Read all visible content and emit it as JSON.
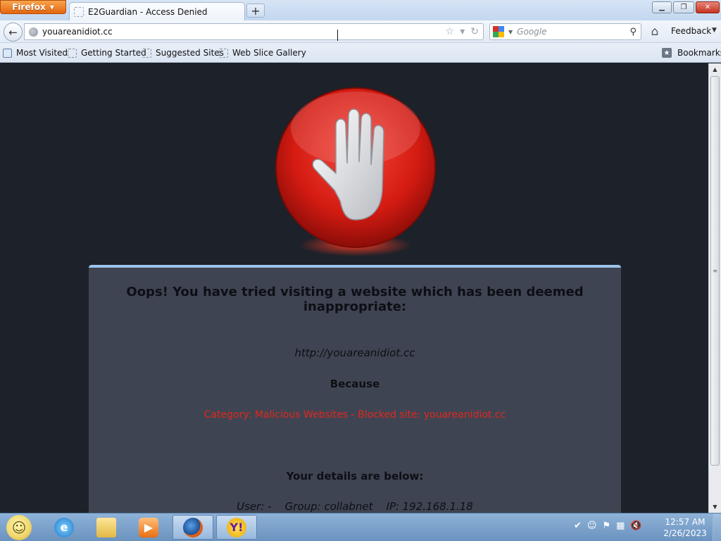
{
  "browser": {
    "menu_button": "Firefox",
    "tab_title": "E2Guardian - Access Denied",
    "new_tab": "+",
    "url": "youareanidiot.cc",
    "search_placeholder": "Google",
    "feedback": "Feedback"
  },
  "bookmarks": [
    "Most Visited",
    "Getting Started",
    "Suggested Sites",
    "Web Slice Gallery"
  ],
  "bookmarks_menu": "Bookmarks",
  "page": {
    "heading": "Oops! You have tried visiting a website which has been deemed inappropriate:",
    "blocked_url": "http://youareanidiot.cc",
    "because": "Because",
    "reason": "Category: Malicious Websites - Blocked site: youareanidiot.cc",
    "details_heading": "Your details are below:",
    "details": "User: -    Group: collabnet    IP: 192.168.1.18"
  },
  "taskbar": {
    "time": "12:57 AM",
    "date": "2/26/2023",
    "apps": [
      "internet-explorer",
      "windows-explorer",
      "media-player",
      "firefox",
      "yahoo-messenger"
    ]
  },
  "colors": {
    "page_background": "#1d2129",
    "panel": "#3f4452",
    "panel_border": "#9cc3ea",
    "reason_text": "#e0281e",
    "stop_sign": "#d81e16"
  }
}
